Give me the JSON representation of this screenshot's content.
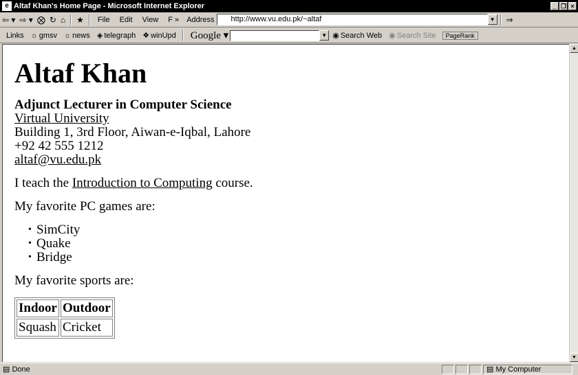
{
  "window": {
    "title": "Altaf Khan's Home Page - Microsoft Internet Explorer",
    "minimize": "_",
    "restore": "❐",
    "close": "×"
  },
  "toolbar": {
    "menus": [
      "File",
      "Edit",
      "View",
      "F »"
    ],
    "address_label": "Address",
    "address_value": "http://www.vu.edu.pk/~altaf",
    "icons": [
      "back-icon",
      "forward-icon",
      "stop-icon",
      "refresh-icon",
      "home-icon",
      "favorites-icon"
    ]
  },
  "links_bar": {
    "label": "Links",
    "items": [
      "gmsv",
      "news",
      "telegraph",
      "winUpd"
    ],
    "google_label": "Google",
    "search_web": "Search Web",
    "search_site": "Search Site",
    "pagerank": "PageRank"
  },
  "page": {
    "heading": "Altaf Khan",
    "position": "Adjunct Lecturer in Computer Science",
    "university": "Virtual University",
    "address": "Building 1, 3rd Floor, Aiwan-e-Iqbal, Lahore",
    "phone": "+92 42 555 1212",
    "email": "altaf@vu.edu.pk",
    "teach_prefix": "I teach the ",
    "course": "Introduction to Computing",
    "teach_suffix": " course.",
    "games_intro": "My favorite PC games are:",
    "games": [
      "SimCity",
      "Quake",
      "Bridge"
    ],
    "sports_intro": "My favorite sports are:",
    "sports_headers": [
      "Indoor",
      "Outdoor"
    ],
    "sports_row": [
      "Squash",
      "Cricket"
    ]
  },
  "status": {
    "text": "Done",
    "zone": "My Computer"
  }
}
